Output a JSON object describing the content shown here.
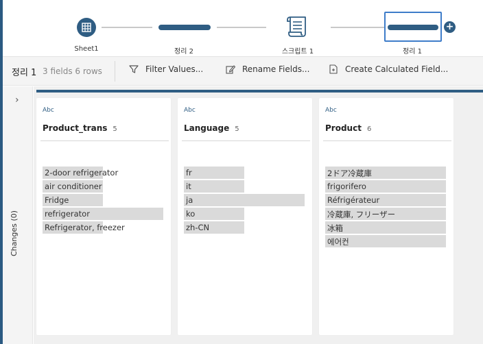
{
  "flow": {
    "nodes": [
      {
        "label": "Sheet1",
        "icon": "table-icon"
      },
      {
        "label": "정리 2",
        "icon": "clean-step-icon"
      },
      {
        "label": "스크립트 1",
        "icon": "script-icon"
      },
      {
        "label": "정리 1",
        "icon": "clean-step-icon",
        "selected": true
      }
    ],
    "add_label": "+"
  },
  "toolbar": {
    "title": "정리 1",
    "meta": "3 fields  6 rows",
    "filter_label": "Filter Values...",
    "rename_label": "Rename Fields...",
    "calc_label": "Create Calculated Field..."
  },
  "side": {
    "expand_glyph": "›",
    "changes_label": "Changes (0)"
  },
  "fields": [
    {
      "type": "Abc",
      "name": "Product_trans",
      "count": "5",
      "values": [
        {
          "text": "2-door refrigerator",
          "fraction": 0.5
        },
        {
          "text": "air conditioner",
          "fraction": 0.5
        },
        {
          "text": "Fridge",
          "fraction": 0.5
        },
        {
          "text": "refrigerator",
          "fraction": 1.0
        },
        {
          "text": "Refrigerator, freezer",
          "fraction": 0.5
        }
      ]
    },
    {
      "type": "Abc",
      "name": "Language",
      "count": "5",
      "values": [
        {
          "text": "fr",
          "fraction": 0.5
        },
        {
          "text": "it",
          "fraction": 0.5
        },
        {
          "text": "ja",
          "fraction": 1.0
        },
        {
          "text": "ko",
          "fraction": 0.5
        },
        {
          "text": "zh-CN",
          "fraction": 0.5
        }
      ]
    },
    {
      "type": "Abc",
      "name": "Product",
      "count": "6",
      "values": [
        {
          "text": "2ドア冷蔵庫",
          "fraction": 1.0
        },
        {
          "text": "frigorifero",
          "fraction": 1.0
        },
        {
          "text": "Réfrigérateur",
          "fraction": 1.0
        },
        {
          "text": "冷蔵庫, フリーザー",
          "fraction": 1.0
        },
        {
          "text": "冰箱",
          "fraction": 1.0
        },
        {
          "text": "에어컨",
          "fraction": 1.0
        }
      ]
    }
  ]
}
